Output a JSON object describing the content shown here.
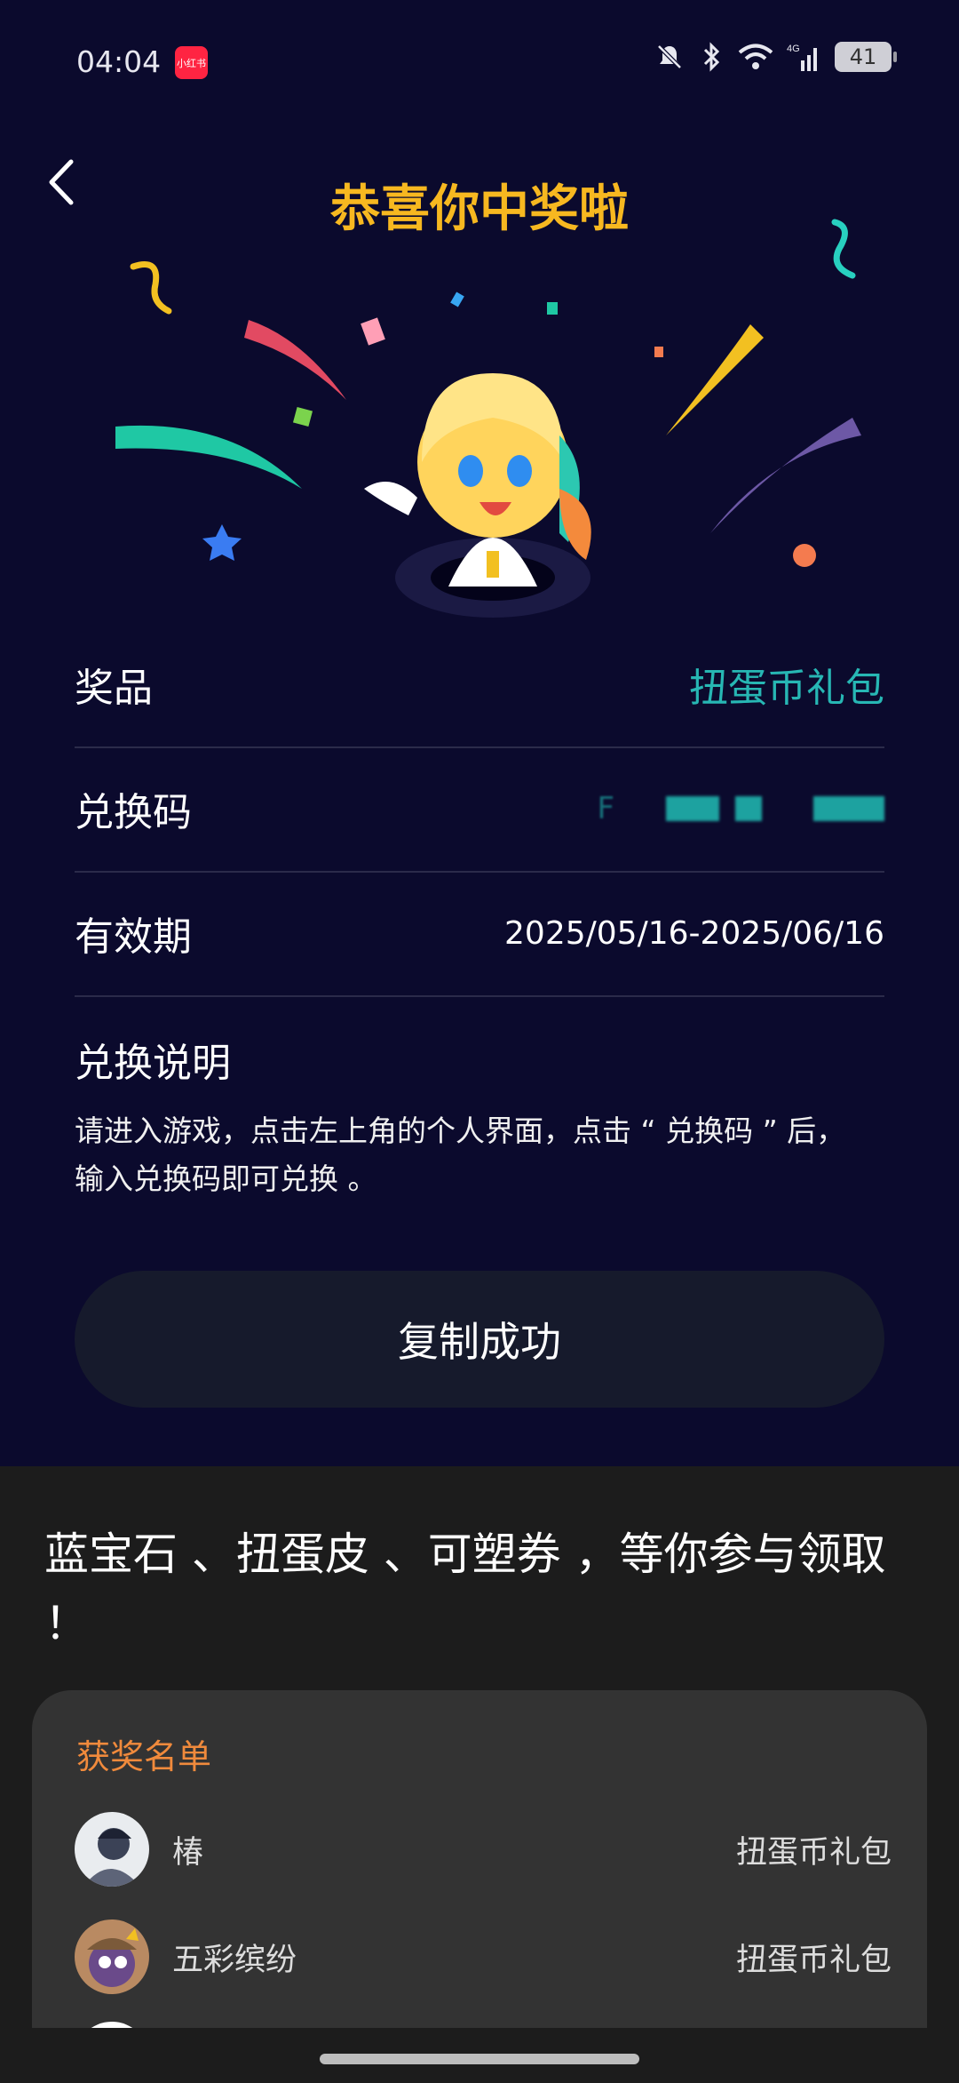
{
  "status": {
    "time": "04:04",
    "app_badge": "小红书",
    "battery": "41"
  },
  "header": {
    "title": "恭喜你中奖啦"
  },
  "details": {
    "prize_label": "奖品",
    "prize_value": "扭蛋币礼包",
    "code_label": "兑换码",
    "code_value": "F",
    "validity_label": "有效期",
    "validity_value": "2025/05/16-2025/06/16",
    "instructions_label": "兑换说明",
    "instructions_text": "请进入游戏，点击左上角的个人界面，点击 “ 兑换码 ” 后，输入兑换码即可兑换 。"
  },
  "copy_button": {
    "label": "复制成功"
  },
  "promo": {
    "text": "蓝宝石 、扭蛋皮 、可塑券 ，等你参与领取 ！"
  },
  "winners": {
    "title": "获奖名单",
    "items": [
      {
        "name": "椿",
        "prize": "扭蛋币礼包"
      },
      {
        "name": "五彩缤纷",
        "prize": "扭蛋币礼包"
      }
    ]
  },
  "colors": {
    "accent_title": "#f7b820",
    "prize_teal": "#27b7b4",
    "winners_title": "#f08a3c",
    "top_bg": "#0b0a2d"
  }
}
